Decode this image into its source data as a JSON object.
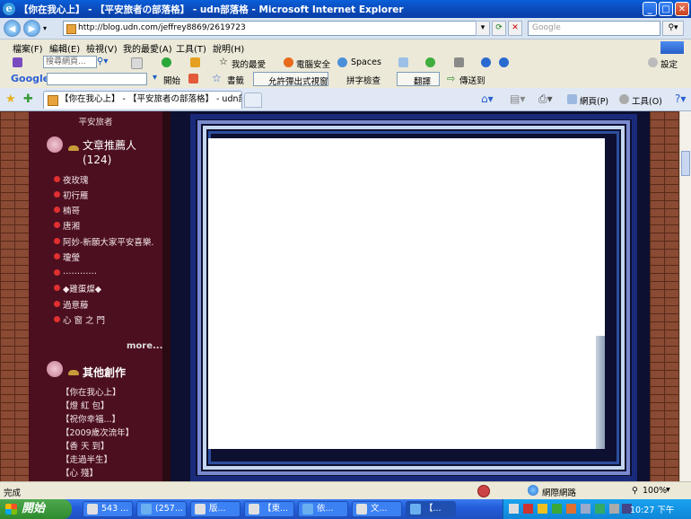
{
  "window": {
    "title": "【你在我心上】 - 【平安旅者の部落格】 - udn部落格 - Microsoft Internet Explorer"
  },
  "address_bar": {
    "url": "http://blog.udn.com/jeffrey8869/2619723",
    "search_placeholder": "Google"
  },
  "menu": {
    "items": [
      "檔案(F)",
      "編輯(E)",
      "檢視(V)",
      "我的最愛(A)",
      "工具(T)",
      "說明(H)"
    ]
  },
  "toolbar1": {
    "search_placeholder": "搜尋網頁...",
    "favorites": "我的最愛",
    "safety": "電腦安全",
    "spaces": "Spaces",
    "settings": "設定"
  },
  "toolbar2": {
    "google": "Google",
    "start": "開始",
    "bookmarks": "書籤",
    "popup": "允許彈出式視窗",
    "spell": "拼字檢查",
    "translate": "翻譯",
    "send": "傳送到"
  },
  "tabs": {
    "active_label": "【你在我心上】 - 【平安旅者の部落格】 - udn部...",
    "page_label": "網頁(P)",
    "tools_label": "工具(O)"
  },
  "sidebar": {
    "caption": "平安旅者",
    "recommenders_title": "文章推薦人(124)",
    "recommenders": [
      "夜玫瑰",
      "初行雁",
      "楠哥",
      "唐湘",
      "阿妙-新願大家平安喜樂.",
      "瓊瑩",
      "…………",
      "◆雞蛋燦◆",
      "過意藤",
      "心 窗 之 門"
    ],
    "more": "more...",
    "works_title": "其他創作",
    "works": [
      "【你在我心上】",
      "【燈 紅 包】",
      "【祝你幸福...】",
      "【2009歲次流年】",
      "【香 天 到】",
      "【走過半生】",
      "【心 殘】"
    ]
  },
  "status": {
    "left": "完成",
    "zone": "網際網路",
    "zoom": "100%"
  },
  "taskbar": {
    "start": "開始",
    "tasks": [
      "543 ...",
      "(257...",
      "版...",
      "【東...",
      "依...",
      "文...",
      "【..."
    ],
    "clock": "10:27 下午"
  },
  "colors": {
    "sidebar_bg": "#4c0f1f",
    "brick": "#8a4a34",
    "xp_blue": "#0b48b7"
  },
  "icons": [
    "ie-icon",
    "back-icon",
    "forward-icon",
    "refresh-icon",
    "stop-icon",
    "search-icon",
    "star-icon",
    "home-icon",
    "print-icon",
    "globe-icon",
    "windows-flag-icon"
  ]
}
